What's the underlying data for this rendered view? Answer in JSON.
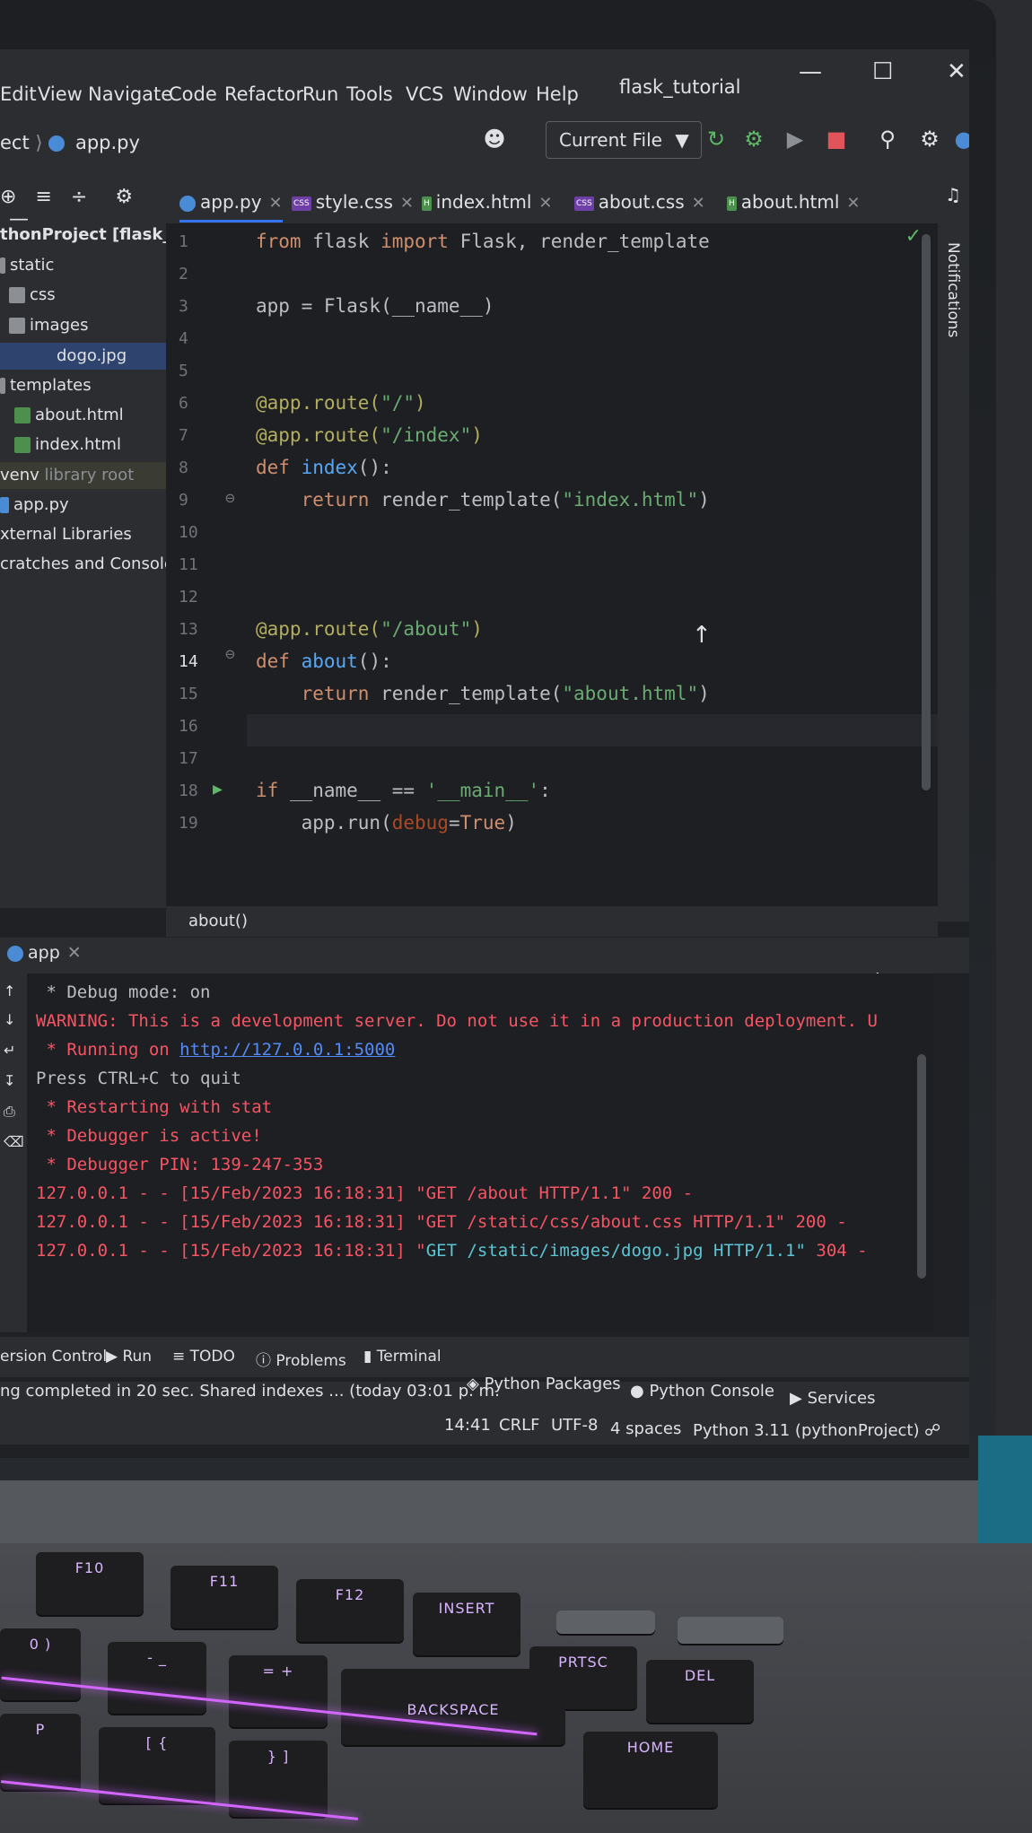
{
  "menu": {
    "items": [
      "Edit",
      "View",
      "Navigate",
      "Code",
      "Refactor",
      "Run",
      "Tools",
      "VCS",
      "Window",
      "Help"
    ],
    "window_title": "flask_tutorial"
  },
  "toolbar": {
    "breadcrumb_project": "ect",
    "breadcrumb_file": "app.py",
    "run_config": "Current File"
  },
  "project_tree": [
    {
      "label": "thonProject [flask_tutori",
      "kind": "root"
    },
    {
      "label": "static",
      "kind": "folder"
    },
    {
      "label": "css",
      "kind": "folder"
    },
    {
      "label": "images",
      "kind": "folder"
    },
    {
      "label": "dogo.jpg",
      "kind": "file-img"
    },
    {
      "label": "templates",
      "kind": "folder"
    },
    {
      "label": "about.html",
      "kind": "file-html"
    },
    {
      "label": "index.html",
      "kind": "file-html"
    },
    {
      "label": "venv",
      "suffix": "library root",
      "kind": "lib"
    },
    {
      "label": "app.py",
      "kind": "file-py"
    },
    {
      "label": "xternal Libraries",
      "kind": "plain"
    },
    {
      "label": "cratches and Consoles",
      "kind": "plain"
    }
  ],
  "tabs": [
    {
      "label": "app.py",
      "type": "py",
      "active": true
    },
    {
      "label": "style.css",
      "type": "CSS"
    },
    {
      "label": "index.html",
      "type": "H"
    },
    {
      "label": "about.css",
      "type": "CSS"
    },
    {
      "label": "about.html",
      "type": "H"
    }
  ],
  "editor": {
    "line_numbers": [
      "1",
      "2",
      "3",
      "4",
      "5",
      "6",
      "7",
      "8",
      "9",
      "10",
      "11",
      "12",
      "13",
      "14",
      "15",
      "16",
      "17",
      "18",
      "19"
    ],
    "code": {
      "l1_kw1": "from",
      "l1_mid": " flask ",
      "l1_kw2": "import",
      "l1_rest": " Flask, render_template",
      "l3": "app = Flask(__name__)",
      "l6_dec": "@app.route(",
      "l6_str": "\"/\"",
      "l6_end": ")",
      "l7_dec": "@app.route(",
      "l7_str": "\"/index\"",
      "l7_end": ")",
      "l8_kw": "def",
      "l8_fn": " index",
      "l8_end": "():",
      "l9_kw": "return",
      "l9_mid": " render_template(",
      "l9_str": "\"index.html\"",
      "l9_end": ")",
      "l12_dec": "@app.route(",
      "l12_str": "\"/about\"",
      "l12_end": ")",
      "l13_kw": "def",
      "l13_fn": " about",
      "l13_end": "():",
      "l14_kw": "return",
      "l14_mid": " render_template(",
      "l14_str": "\"about.html\"",
      "l14_end": ")",
      "l17_kw": "if",
      "l17_mid": " __name__ == ",
      "l17_str": "'__main__'",
      "l17_end": ":",
      "l18_a": "app.run(",
      "l18_param": "debug",
      "l18_eq": "=",
      "l18_kw": "True",
      "l18_end": ")"
    },
    "footer_context": "about()"
  },
  "run_panel": {
    "tab_label": "app",
    "lines": [
      {
        "text": " * Debug mode: on",
        "style": "white"
      },
      {
        "text": "WARNING: This is a development server. Do not use it in a production deployment. U",
        "style": "red"
      },
      {
        "prefix": " * Running on ",
        "link": "http://127.0.0.1:5000",
        "style": "red"
      },
      {
        "text": "Press CTRL+C to quit",
        "style": "white"
      },
      {
        "text": " * Restarting with stat",
        "style": "red"
      },
      {
        "text": " * Debugger is active!",
        "style": "red"
      },
      {
        "text": " * Debugger PIN: 139-247-353",
        "style": "red"
      },
      {
        "text": "127.0.0.1 - - [15/Feb/2023 16:18:31] \"GET /about HTTP/1.1\" 200 -",
        "style": "red"
      },
      {
        "text": "127.0.0.1 - - [15/Feb/2023 16:18:31] \"GET /static/css/about.css HTTP/1.1\" 200 -",
        "style": "red"
      },
      {
        "prefix": "127.0.0.1 - - [15/Feb/2023 16:18:31] \"",
        "cyan": "GET /static/images/dogo.jpg HTTP/1.1\"",
        "suffix": " 304 -",
        "style": "mixed"
      }
    ]
  },
  "tool_windows": [
    "ersion Control",
    "Run",
    "TODO",
    "Problems",
    "Terminal",
    "Python Packages",
    "Python Console",
    "Services"
  ],
  "status": {
    "message": "ng completed in 20 sec. Shared indexes ... (today 03:01 p. m.",
    "position": "14:41",
    "line_sep": "CRLF",
    "encoding": "UTF-8",
    "indent": "4 spaces",
    "interpreter": "Python 3.11 (pythonProject)"
  },
  "notifications_label": "Notifications",
  "keys": {
    "f10": "F10",
    "f11": "F11",
    "f12": "F12",
    "insert": "INSERT",
    "prtsc": "PRTSC",
    "del": "DEL",
    "backspace": "BACKSPACE",
    "home": "HOME",
    "minus": "- _",
    "equals": "= +",
    "paren": "0 )",
    "brackets": "[ {",
    "brackets2": "} ]",
    "p": "P"
  },
  "colors": {
    "accent": "#3574f0",
    "console_red": "#f75464",
    "link": "#548af7",
    "keyboard_led": "#d266ff"
  }
}
